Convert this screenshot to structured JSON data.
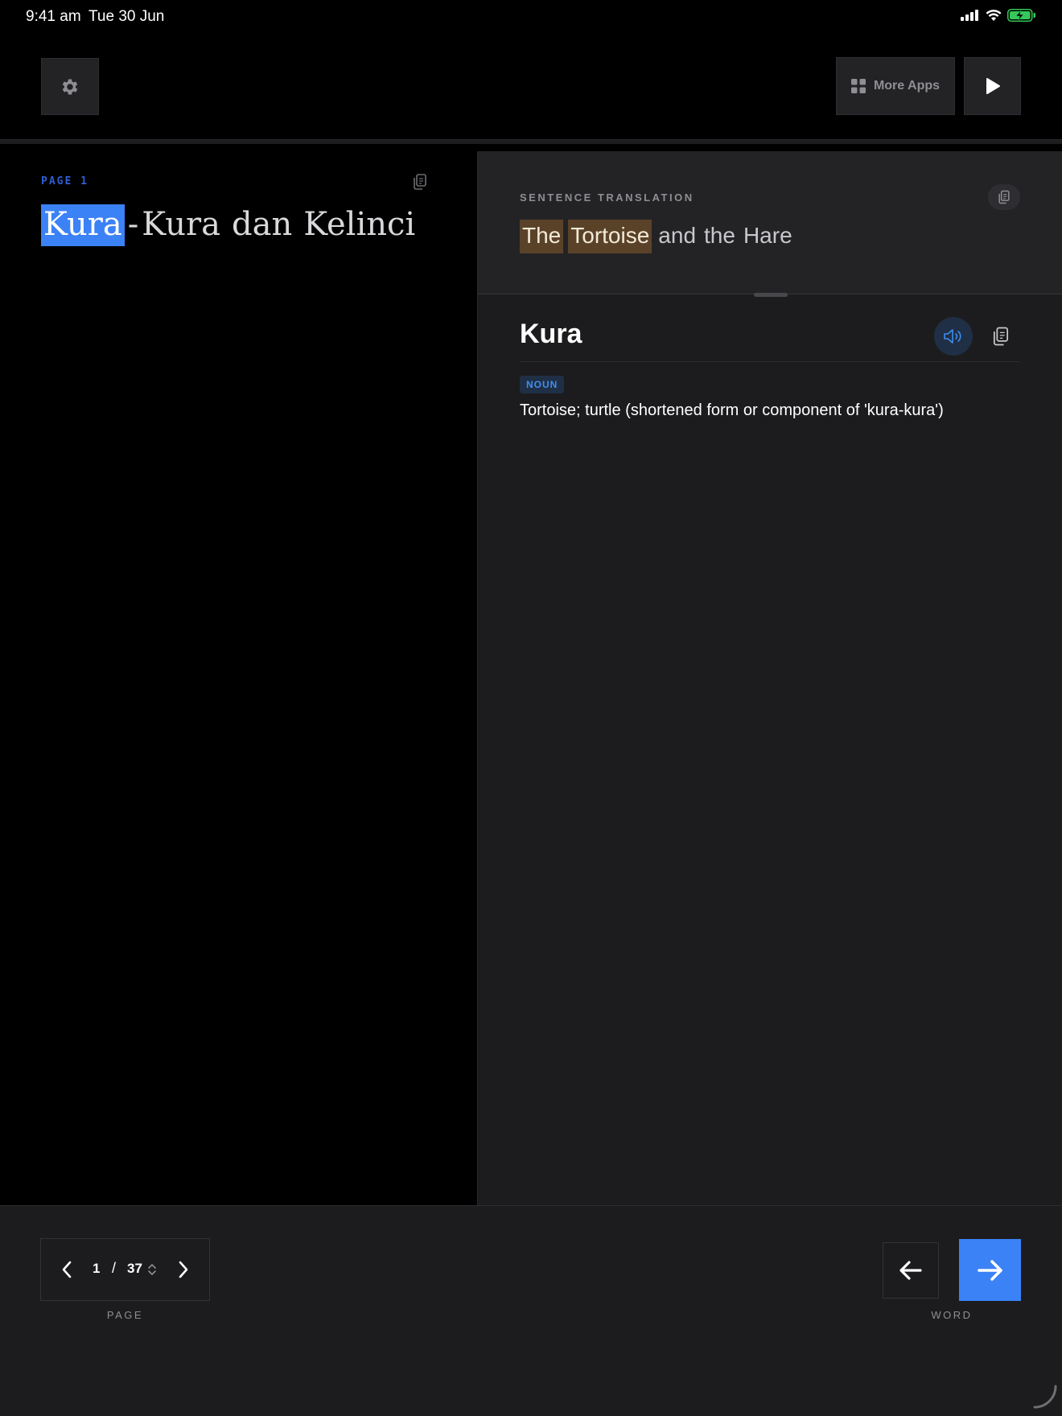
{
  "status_bar": {
    "time": "9:41 am",
    "date": "Tue 30 Jun",
    "battery_color": "#34c759"
  },
  "toolbar": {
    "settings_icon": "gear-icon",
    "more_apps_label": "More Apps",
    "more_apps_icon": "grid-icon",
    "play_icon": "play-icon"
  },
  "source": {
    "page_label": "PAGE 1",
    "title_words": [
      "Kura",
      "-",
      "Kura",
      "dan",
      "Kelinci"
    ],
    "highlighted_word": "Kura",
    "highlight_color": "#3b82f6"
  },
  "translation": {
    "label": "SENTENCE TRANSLATION",
    "words": [
      "The",
      "Tortoise",
      "and",
      "the",
      "Hare"
    ],
    "highlighted": [
      "The",
      "Tortoise"
    ],
    "highlight_color": "#5a4229"
  },
  "dictionary": {
    "word": "Kura",
    "part_of_speech": "NOUN",
    "definition": "Tortoise; turtle (shortened form or component of 'kura-kura')",
    "accent_color": "#3f8ef0"
  },
  "navigation": {
    "current_page": "1",
    "separator": "/",
    "total_pages": "37",
    "page_caption": "PAGE",
    "word_caption": "WORD",
    "accent_color": "#3b82f6"
  }
}
